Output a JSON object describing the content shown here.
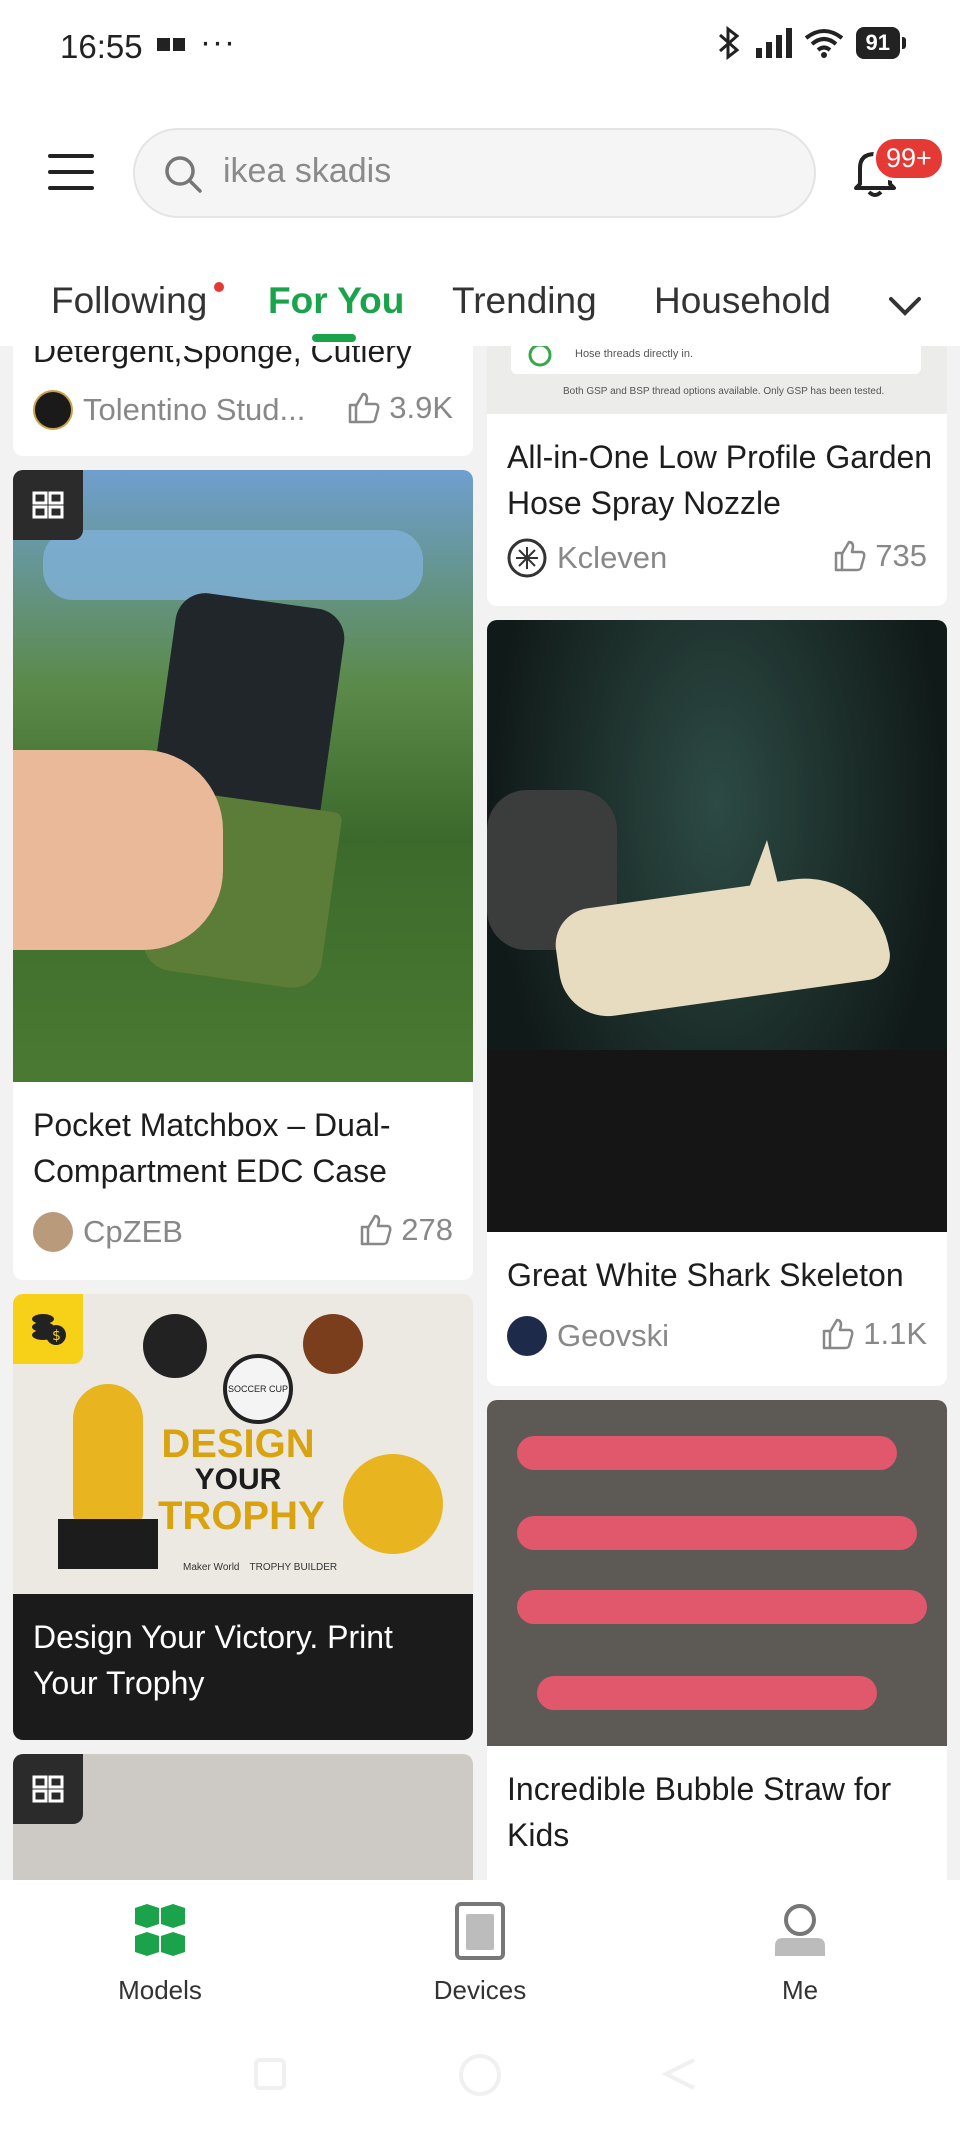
{
  "status_bar": {
    "time": "16:55",
    "dots": "···",
    "battery": "91"
  },
  "header": {
    "search_value": "ikea skadis",
    "notification_badge": "99+"
  },
  "tabs": [
    {
      "label": "Following",
      "has_dot": true
    },
    {
      "label": "For You",
      "active": true
    },
    {
      "label": "Trending"
    },
    {
      "label": "Household"
    }
  ],
  "cards": {
    "partial_top_left": {
      "title": "Detergent,Sponge, Cutlery",
      "author": "Tolentino Stud...",
      "likes": "3.9K"
    },
    "partial_top_right": {
      "image_text_1": "Hose threads directly in.",
      "image_text_2": "Both GSP and BSP thread options available. Only GSP has been tested.",
      "title": "All-in-One Low Profile Garden Hose Spray Nozzle",
      "author": "Kcleven",
      "likes": "735"
    },
    "matchbox": {
      "title": "Pocket Matchbox – Dual-Compartment EDC Case",
      "author": "CpZEB",
      "likes": "278"
    },
    "shark": {
      "title": "Great White Shark Skeleton",
      "author": "Geovski",
      "likes": "1.1K"
    },
    "trophy": {
      "title": "Design Your Victory. Print Your Trophy",
      "img_line1": "DESIGN",
      "img_line2": "YOUR",
      "img_line3": "TROPHY",
      "img_brand1": "Maker World",
      "img_brand2": "TROPHY BUILDER",
      "img_medal": "SOCCER CUP"
    },
    "bubble": {
      "title": "Incredible Bubble Straw for Kids"
    }
  },
  "bottom_nav": [
    {
      "label": "Models",
      "active": true
    },
    {
      "label": "Devices"
    },
    {
      "label": "Me"
    }
  ],
  "colors": {
    "accent": "#1aa34a",
    "badge": "#e53935"
  }
}
